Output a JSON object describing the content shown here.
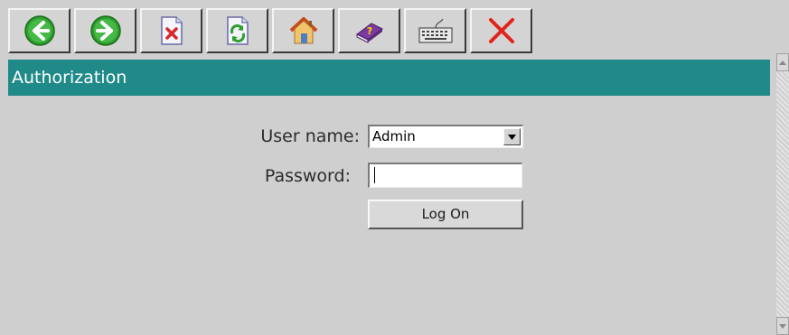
{
  "toolbar": {
    "buttons": [
      {
        "name": "back",
        "icon": "arrow-left-icon"
      },
      {
        "name": "forward",
        "icon": "arrow-right-icon"
      },
      {
        "name": "delete",
        "icon": "delete-document-icon"
      },
      {
        "name": "refresh",
        "icon": "refresh-icon"
      },
      {
        "name": "home",
        "icon": "home-icon"
      },
      {
        "name": "help",
        "icon": "help-book-icon"
      },
      {
        "name": "keyboard",
        "icon": "keyboard-icon"
      },
      {
        "name": "close",
        "icon": "close-icon"
      }
    ]
  },
  "panel": {
    "title": "Authorization"
  },
  "form": {
    "username_label": "User name:",
    "username_value": "Admin",
    "password_label": "Password:",
    "password_value": "",
    "logon_label": "Log On"
  },
  "colors": {
    "title_bar": "#1f8a88",
    "background": "#cfcfcf",
    "arrow_green": "#2e9e2e",
    "close_red": "#e0241c"
  }
}
